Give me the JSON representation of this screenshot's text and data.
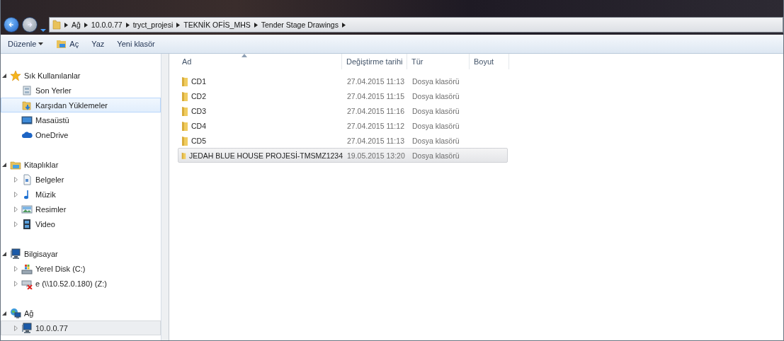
{
  "address_bar": {
    "path": [
      "Ağ",
      "10.0.0.77",
      "tryct_projesi",
      "TEKNİK OFİS_MHS",
      "Tender Stage Drawings"
    ]
  },
  "toolbar": [
    {
      "label": "Düzenle",
      "kind": "menu"
    },
    {
      "label": "Aç",
      "kind": "open"
    },
    {
      "label": "Yaz",
      "kind": "plain"
    },
    {
      "label": "Yeni klasör",
      "kind": "plain"
    }
  ],
  "sidebar": {
    "groups": [
      {
        "label": "Sık Kullanılanlar",
        "kind": "star",
        "expanded": true,
        "children": [
          {
            "label": "Son Yerler",
            "kind": "recent",
            "expandable": false,
            "selected": false,
            "hovered": false
          },
          {
            "label": "Karşıdan Yüklemeler",
            "kind": "downloads",
            "expandable": false,
            "selected": true,
            "hovered": false
          },
          {
            "label": "Masaüstü",
            "kind": "desktop",
            "expandable": false,
            "selected": false,
            "hovered": false
          },
          {
            "label": "OneDrive",
            "kind": "cloud",
            "expandable": false,
            "selected": false,
            "hovered": false
          }
        ]
      },
      {
        "label": "Kitaplıklar",
        "kind": "library",
        "expanded": true,
        "children": [
          {
            "label": "Belgeler",
            "kind": "document",
            "expandable": true,
            "selected": false,
            "hovered": false
          },
          {
            "label": "Müzik",
            "kind": "music",
            "expandable": true,
            "selected": false,
            "hovered": false
          },
          {
            "label": "Resimler",
            "kind": "pictures",
            "expandable": true,
            "selected": false,
            "hovered": false
          },
          {
            "label": "Video",
            "kind": "video",
            "expandable": true,
            "selected": false,
            "hovered": false
          }
        ]
      },
      {
        "label": "Bilgisayar",
        "kind": "computer",
        "expanded": true,
        "children": [
          {
            "label": "Yerel Disk (C:)",
            "kind": "disk",
            "expandable": true,
            "selected": false,
            "hovered": false
          },
          {
            "label": "e (\\\\10.52.0.180) (Z:)",
            "kind": "netdrive",
            "expandable": true,
            "selected": false,
            "hovered": false
          }
        ]
      },
      {
        "label": "Ağ",
        "kind": "network",
        "expanded": true,
        "children": [
          {
            "label": "10.0.0.77",
            "kind": "computer",
            "expandable": true,
            "selected": false,
            "hovered": true
          }
        ]
      }
    ]
  },
  "table": {
    "columns": [
      {
        "label": "Ad",
        "sorted": true
      },
      {
        "label": "Değiştirme tarihi",
        "sorted": false
      },
      {
        "label": "Tür",
        "sorted": false
      },
      {
        "label": "Boyut",
        "sorted": false
      }
    ],
    "rows": [
      {
        "name": "CD1",
        "modified": "27.04.2015 11:13",
        "type": "Dosya klasörü",
        "selected": false
      },
      {
        "name": "CD2",
        "modified": "27.04.2015 11:15",
        "type": "Dosya klasörü",
        "selected": false
      },
      {
        "name": "CD3",
        "modified": "27.04.2015 11:16",
        "type": "Dosya klasörü",
        "selected": false
      },
      {
        "name": "CD4",
        "modified": "27.04.2015 11:12",
        "type": "Dosya klasörü",
        "selected": false
      },
      {
        "name": "CD5",
        "modified": "27.04.2015 11:13",
        "type": "Dosya klasörü",
        "selected": false
      },
      {
        "name": "JEDAH BLUE HOUSE PROJESİ-TMSMZ1234",
        "modified": "19.05.2015 13:20",
        "type": "Dosya klasörü",
        "selected": true
      }
    ]
  }
}
